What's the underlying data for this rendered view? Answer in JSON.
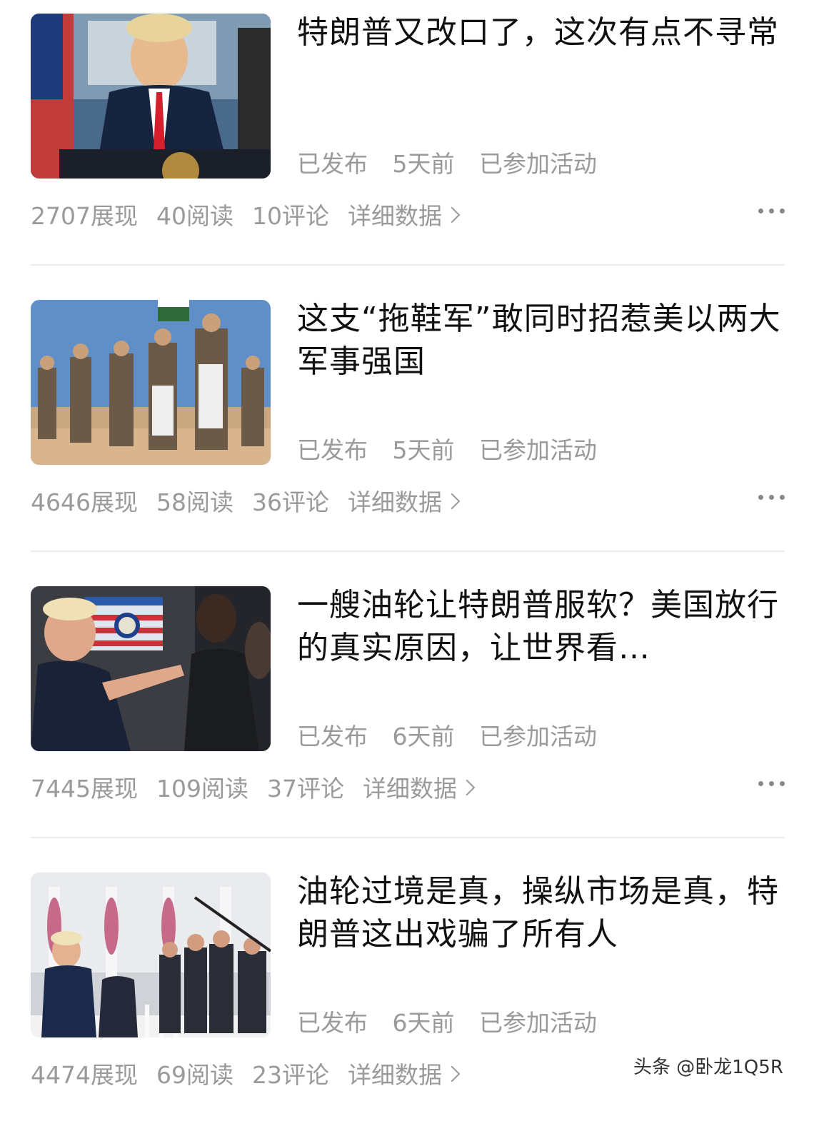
{
  "articles": [
    {
      "title": "特朗普又改口了，这次有点不寻常",
      "status": "已发布",
      "time": "5天前",
      "activity": "已参加活动",
      "views": "2707展现",
      "reads": "40阅读",
      "comments": "10评论",
      "details": "详细数据"
    },
    {
      "title": "这支“拖鞋军”敢同时招惹美以两大军事强国",
      "status": "已发布",
      "time": "5天前",
      "activity": "已参加活动",
      "views": "4646展现",
      "reads": "58阅读",
      "comments": "36评论",
      "details": "详细数据"
    },
    {
      "title": "一艘油轮让特朗普服软？美国放行的真实原因，让世界看…",
      "status": "已发布",
      "time": "6天前",
      "activity": "已参加活动",
      "views": "7445展现",
      "reads": "109阅读",
      "comments": "37评论",
      "details": "详细数据"
    },
    {
      "title": "油轮过境是真，操纵市场是真，特朗普这出戏骗了所有人",
      "status": "已发布",
      "time": "6天前",
      "activity": "已参加活动",
      "views": "4474展现",
      "reads": "69阅读",
      "comments": "23评论",
      "details": "详细数据"
    }
  ],
  "watermark": "头条 @卧龙1Q5R"
}
